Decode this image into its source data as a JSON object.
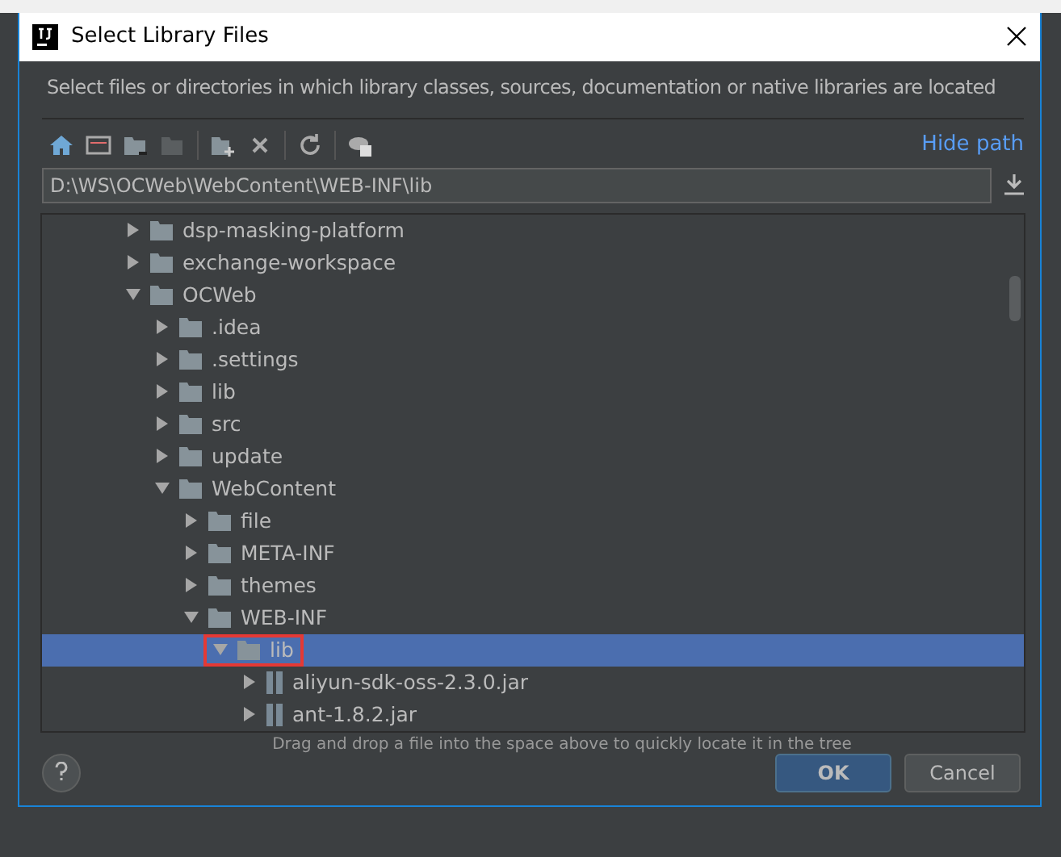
{
  "window": {
    "title": "Select Library Files"
  },
  "description": "Select files or directories in which library classes, sources, documentation or native libraries are located",
  "toolbar": {
    "hide_path_link": "Hide path"
  },
  "path_field": {
    "value": "D:\\WS\\OCWeb\\WebContent\\WEB-INF\\lib"
  },
  "tree": {
    "items": [
      {
        "label": "dsp-masking-platform",
        "kind": "folder",
        "expanded": false,
        "selected": false
      },
      {
        "label": "exchange-workspace",
        "kind": "folder",
        "expanded": false,
        "selected": false
      },
      {
        "label": "OCWeb",
        "kind": "folder",
        "expanded": true,
        "selected": false,
        "children": [
          {
            "label": ".idea",
            "kind": "folder",
            "expanded": false,
            "selected": false
          },
          {
            "label": ".settings",
            "kind": "folder",
            "expanded": false,
            "selected": false
          },
          {
            "label": "lib",
            "kind": "folder",
            "expanded": false,
            "selected": false
          },
          {
            "label": "src",
            "kind": "folder",
            "expanded": false,
            "selected": false
          },
          {
            "label": "update",
            "kind": "folder",
            "expanded": false,
            "selected": false
          },
          {
            "label": "WebContent",
            "kind": "folder",
            "expanded": true,
            "selected": false,
            "children": [
              {
                "label": "file",
                "kind": "folder",
                "expanded": false,
                "selected": false
              },
              {
                "label": "META-INF",
                "kind": "folder",
                "expanded": false,
                "selected": false
              },
              {
                "label": "themes",
                "kind": "folder",
                "expanded": false,
                "selected": false
              },
              {
                "label": "WEB-INF",
                "kind": "folder",
                "expanded": true,
                "selected": false,
                "children": [
                  {
                    "label": "lib",
                    "kind": "folder",
                    "expanded": true,
                    "selected": true,
                    "highlighted": true,
                    "children": [
                      {
                        "label": "aliyun-sdk-oss-2.3.0.jar",
                        "kind": "jar",
                        "expanded": false,
                        "selected": false
                      },
                      {
                        "label": "ant-1.8.2.jar",
                        "kind": "jar",
                        "expanded": false,
                        "selected": false
                      }
                    ]
                  }
                ]
              }
            ]
          }
        ]
      }
    ]
  },
  "hint": "Drag and drop a file into the space above to quickly locate it in the tree",
  "buttons": [
    {
      "label": "OK",
      "kind": "primary"
    },
    {
      "label": "Cancel",
      "kind": "secondary"
    }
  ]
}
